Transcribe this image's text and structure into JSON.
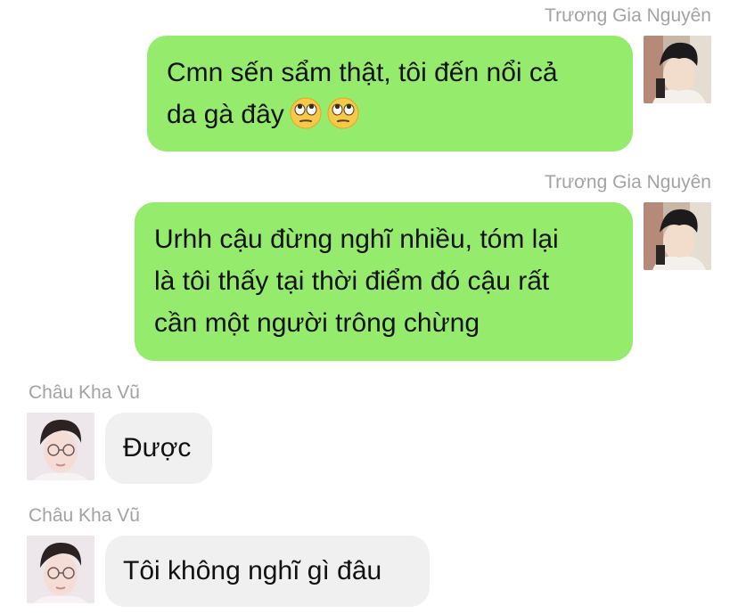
{
  "messages": [
    {
      "sender": "Trương Gia Nguyên",
      "side": "right",
      "lines": [
        "Cmn sến sẩm thật, tôi đến nổi cả",
        "da gà đây"
      ],
      "emoji": [
        "face-with-rolling-eyes",
        "face-with-rolling-eyes"
      ]
    },
    {
      "sender": "Trương Gia Nguyên",
      "side": "right",
      "lines": [
        "Urhh cậu đừng nghĩ nhiều, tóm lại",
        "là tôi thấy tại thời điểm đó cậu rất",
        "cần một người trông chừng"
      ]
    },
    {
      "sender": "Châu Kha Vũ",
      "side": "left",
      "lines": [
        "Được"
      ]
    },
    {
      "sender": "Châu Kha Vũ",
      "side": "left",
      "lines": [
        "Tôi không nghĩ gì đâu"
      ]
    }
  ],
  "colors": {
    "sent_bubble": "#95eb6c",
    "received_bubble": "#f0f0f0",
    "sender_name": "#a3a3a3"
  }
}
